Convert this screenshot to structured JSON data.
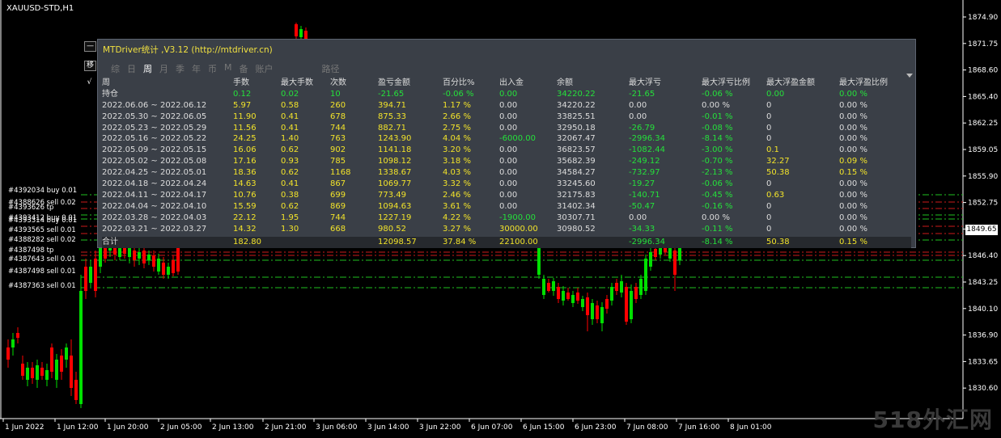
{
  "symbol": "XAUUSD-STD,H1",
  "price_axis": [
    "1874.90",
    "1871.75",
    "1868.60",
    "1865.40",
    "1862.25",
    "1859.05",
    "1855.90",
    "1852.75",
    "1849.65",
    "1846.40",
    "1843.25",
    "1840.10",
    "1836.90",
    "1833.65",
    "1830.60"
  ],
  "current_price": "1849.65",
  "time_axis": [
    "1 Jun 2022",
    "1 Jun 12:00",
    "1 Jun 20:00",
    "2 Jun 05:00",
    "2 Jun 13:00",
    "2 Jun 21:00",
    "3 Jun 06:00",
    "3 Jun 14:00",
    "3 Jun 22:00",
    "6 Jun 07:00",
    "6 Jun 15:00",
    "6 Jun 23:00",
    "7 Jun 08:00",
    "7 Jun 16:00",
    "8 Jun 01:00"
  ],
  "orders": [
    "#4392034 buy 0.01",
    "#4388626 sell 0.02",
    "#4393626 tp",
    "#4393412 buy 0.01",
    "#4393314 buy 0.01",
    "#4393565 sell 0.01",
    "#4388282 sell 0.02",
    "#4387498 tp",
    "#4387643 sell 0.01",
    "#4387498 sell 0.01",
    "#4387363 sell 0.01"
  ],
  "watermark": "518外汇网",
  "panel": {
    "buttons": {
      "minimize": "—",
      "toggle": "移",
      "check": "√"
    },
    "title": "MTDriver统计 ,V3.12 (http://mtdriver.cn)",
    "tabs": [
      "综",
      "日",
      "周",
      "月",
      "季",
      "年",
      "币",
      "M",
      "备",
      "账户",
      "路径"
    ],
    "headers": [
      "周",
      "手数",
      "最大手数",
      "次数",
      "盈亏金额",
      "百分比%",
      "出入金",
      "余额",
      "最大浮亏",
      "最大浮亏比例",
      "最大浮盈金额",
      "最大浮盈比例"
    ],
    "open_row": [
      "持仓",
      "0.12",
      "0.02",
      "10",
      "-21.65",
      "-0.06 %",
      "0.00",
      "34220.22",
      "-21.65",
      "-0.06 %",
      "0.00",
      "0.00 %"
    ],
    "rows": [
      [
        "2022.06.06 ~ 2022.06.12",
        "5.97",
        "0.58",
        "260",
        "394.71",
        "1.17 %",
        "0.00",
        "34220.22",
        "0.00",
        "0.00 %",
        "0",
        "0.00 %"
      ],
      [
        "2022.05.30 ~ 2022.06.05",
        "11.90",
        "0.41",
        "678",
        "875.33",
        "2.66 %",
        "0.00",
        "33825.51",
        "0.00",
        "-0.01 %",
        "0",
        "0.00 %"
      ],
      [
        "2022.05.23 ~ 2022.05.29",
        "11.56",
        "0.41",
        "744",
        "882.71",
        "2.75 %",
        "0.00",
        "32950.18",
        "-26.79",
        "-0.08 %",
        "0",
        "0.00 %"
      ],
      [
        "2022.05.16 ~ 2022.05.22",
        "24.25",
        "1.40",
        "763",
        "1243.90",
        "4.04 %",
        "-6000.00",
        "32067.47",
        "-2996.34",
        "-8.14 %",
        "0",
        "0.00 %"
      ],
      [
        "2022.05.09 ~ 2022.05.15",
        "16.06",
        "0.62",
        "902",
        "1141.18",
        "3.20 %",
        "0.00",
        "36823.57",
        "-1082.44",
        "-3.00 %",
        "0.1",
        "0.00 %"
      ],
      [
        "2022.05.02 ~ 2022.05.08",
        "17.16",
        "0.93",
        "785",
        "1098.12",
        "3.18 %",
        "0.00",
        "35682.39",
        "-249.12",
        "-0.70 %",
        "32.27",
        "0.09 %"
      ],
      [
        "2022.04.25 ~ 2022.05.01",
        "18.36",
        "0.62",
        "1168",
        "1338.67",
        "4.03 %",
        "0.00",
        "34584.27",
        "-732.97",
        "-2.13 %",
        "50.38",
        "0.15 %"
      ],
      [
        "2022.04.18 ~ 2022.04.24",
        "14.63",
        "0.41",
        "867",
        "1069.77",
        "3.32 %",
        "0.00",
        "33245.60",
        "-19.27",
        "-0.06 %",
        "0",
        "0.00 %"
      ],
      [
        "2022.04.11 ~ 2022.04.17",
        "10.76",
        "0.38",
        "699",
        "773.49",
        "2.46 %",
        "0.00",
        "32175.83",
        "-140.71",
        "-0.45 %",
        "0.63",
        "0.00 %"
      ],
      [
        "2022.04.04 ~ 2022.04.10",
        "15.59",
        "0.62",
        "869",
        "1094.63",
        "3.61 %",
        "0.00",
        "31402.34",
        "-50.47",
        "-0.16 %",
        "0",
        "0.00 %"
      ],
      [
        "2022.03.28 ~ 2022.04.03",
        "22.12",
        "1.95",
        "744",
        "1227.19",
        "4.22 %",
        "-1900.00",
        "30307.71",
        "0.00",
        "0.00 %",
        "0",
        "0.00 %"
      ],
      [
        "2022.03.21 ~ 2022.03.27",
        "14.32",
        "1.30",
        "668",
        "980.52",
        "3.27 %",
        "30000.00",
        "30980.52",
        "-34.33",
        "-0.11 %",
        "0",
        "0.00 %"
      ]
    ],
    "total_row": [
      "合计",
      "182.80",
      "",
      "",
      "12098.57",
      "37.84 %",
      "22100.00",
      "",
      "-2996.34",
      "-8.14 %",
      "50.38",
      "0.15 %"
    ]
  },
  "colors": {
    "bull": "#00e000",
    "bear": "#ff0000",
    "panel_bg": "#3a3f47",
    "green_text": "#25e03b",
    "yellow_text": "#f2e32a"
  }
}
